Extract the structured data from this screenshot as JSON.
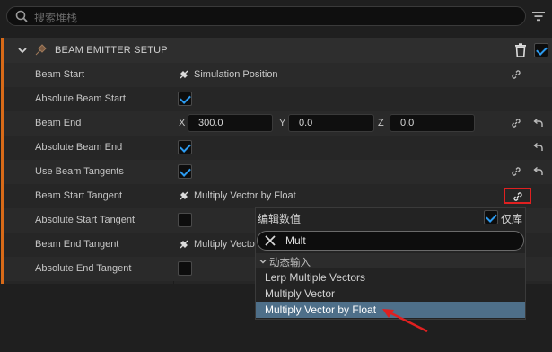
{
  "search": {
    "placeholder": "搜索堆栈"
  },
  "section": {
    "title": "BEAM EMITTER SETUP"
  },
  "rows": [
    {
      "label": "Beam Start",
      "value": "Simulation Position"
    },
    {
      "label": "Absolute Beam Start",
      "checked": true
    },
    {
      "label": "Beam End",
      "x_label": "X",
      "x": "300.0",
      "y_label": "Y",
      "y": "0.0",
      "z_label": "Z",
      "z": "0.0"
    },
    {
      "label": "Absolute Beam End",
      "checked": true
    },
    {
      "label": "Use Beam Tangents",
      "checked": true
    },
    {
      "label": "Beam Start Tangent",
      "value": "Multiply Vector by Float"
    },
    {
      "label": "Absolute Start Tangent",
      "checked": false
    },
    {
      "label": "Beam End Tangent",
      "value": "Multiply Vector by Float"
    },
    {
      "label": "Absolute End Tangent",
      "checked": false
    }
  ],
  "dropdown": {
    "title": "编辑数值",
    "library_only_label": "仅库",
    "library_only_checked": true,
    "search_value": "Mult",
    "category": "动态输入",
    "items": [
      "Lerp Multiple Vectors",
      "Multiply Vector",
      "Multiply Vector by Float"
    ],
    "selected_index": 2
  },
  "colors": {
    "accent": "#d86a18",
    "checkbox": "#2c9bf0",
    "highlight": "#e02020",
    "selection": "#4e6f89"
  }
}
